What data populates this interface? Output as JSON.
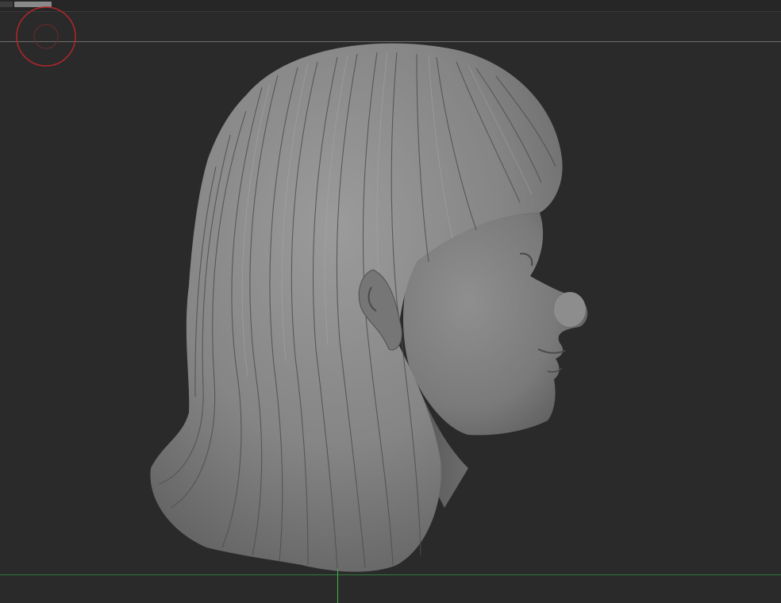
{
  "viewport": {
    "background_color": "#2a2a2a",
    "horizon_line_color": "#6f6f6f",
    "ground_line_color": "#2f7a3a",
    "axis_color": "#3fb64a"
  },
  "gizmo": {
    "icon": "orbit-gizmo-icon",
    "color": "#b3262a"
  },
  "model": {
    "icon": "sculpted-head-model",
    "material_color": "#8c8c8c"
  }
}
